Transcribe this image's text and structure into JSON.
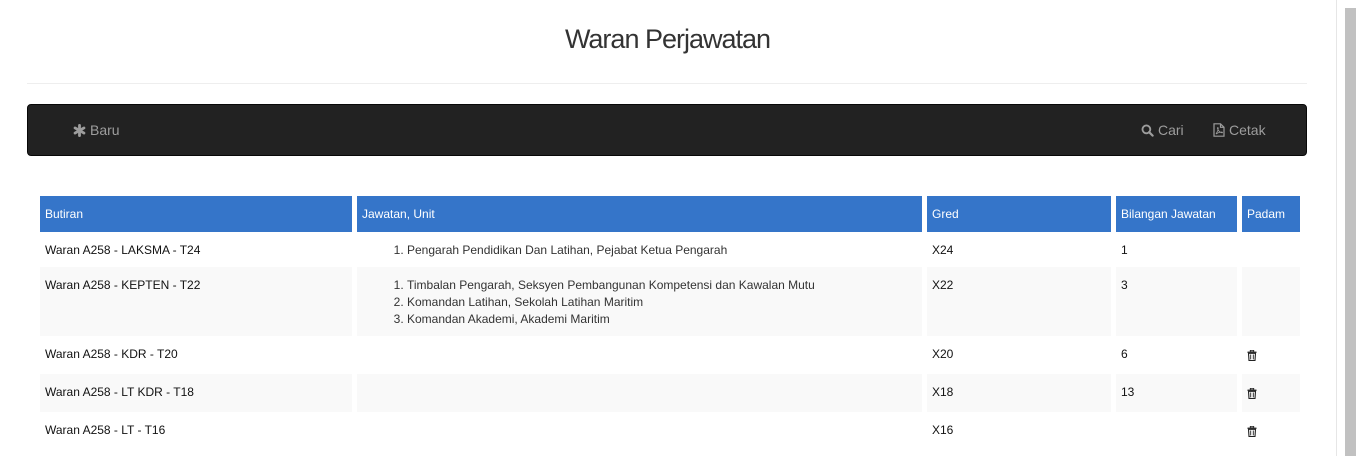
{
  "page": {
    "title": "Waran Perjawatan"
  },
  "navbar": {
    "baru_label": "Baru",
    "cari_label": "Cari",
    "cetak_label": "Cetak"
  },
  "table": {
    "headers": [
      "Butiran",
      "Jawatan, Unit",
      "Gred",
      "Bilangan Jawatan",
      "Padam"
    ],
    "rows": [
      {
        "butiran": "Waran A258 - LAKSMA - T24",
        "units": [
          "Pengarah Pendidikan Dan Latihan, Pejabat Ketua Pengarah"
        ],
        "gred": "X24",
        "bilangan": "1",
        "deletable": false
      },
      {
        "butiran": "Waran A258 - KEPTEN - T22",
        "units": [
          "Timbalan Pengarah, Seksyen Pembangunan Kompetensi dan Kawalan Mutu",
          "Komandan Latihan, Sekolah Latihan Maritim",
          "Komandan Akademi, Akademi Maritim"
        ],
        "gred": "X22",
        "bilangan": "3",
        "deletable": false
      },
      {
        "butiran": "Waran A258 - KDR - T20",
        "units": [],
        "gred": "X20",
        "bilangan": "6",
        "deletable": true
      },
      {
        "butiran": "Waran A258 - LT KDR - T18",
        "units": [],
        "gred": "X18",
        "bilangan": "13",
        "deletable": true
      },
      {
        "butiran": "Waran A258 - LT - T16",
        "units": [],
        "gred": "X16",
        "bilangan": "",
        "deletable": true
      }
    ]
  },
  "icons": {
    "baru": "asterisk-icon",
    "cari": "search-icon",
    "cetak": "pdf-file-icon",
    "padam": "trash-icon"
  },
  "colors": {
    "navbar_bg": "#222222",
    "navbar_text": "#9d9d9d",
    "header_bg": "#3575c9",
    "row_alt_bg": "#f9f9f9"
  }
}
